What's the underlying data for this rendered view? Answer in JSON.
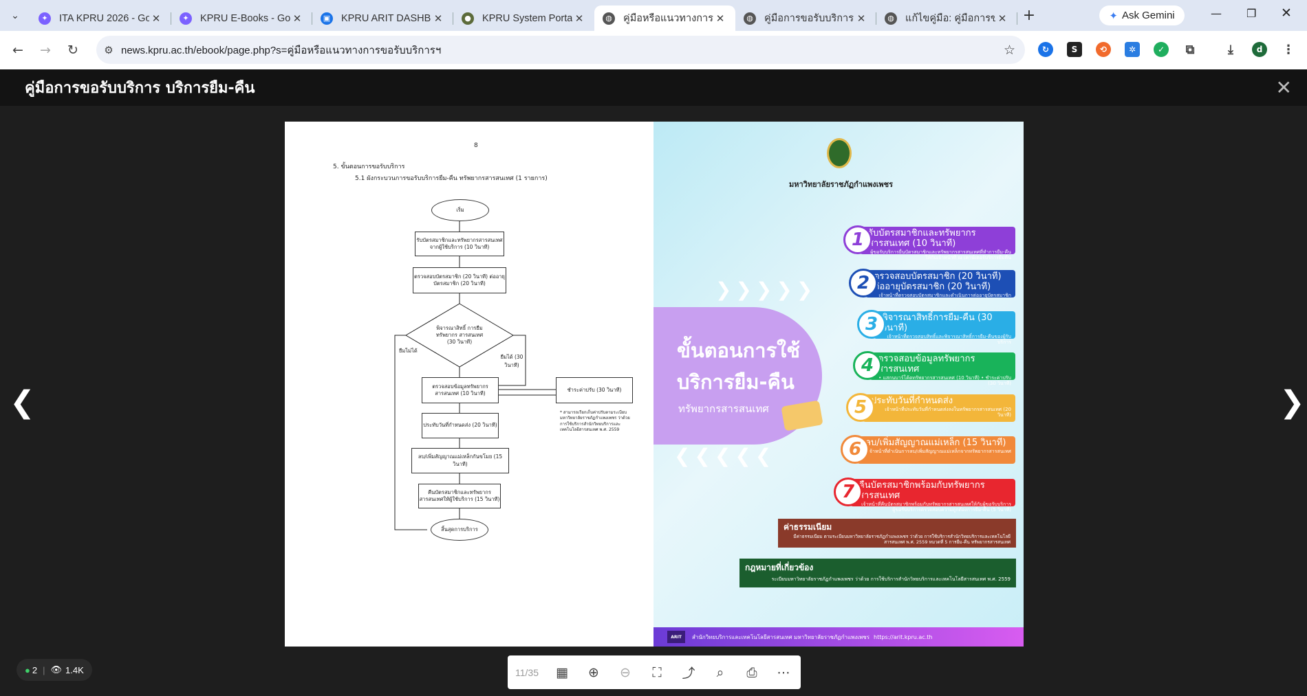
{
  "tabs": [
    {
      "title": "ITA KPRU 2026 - Goo",
      "color": "#7b61ff",
      "glyph": "✦"
    },
    {
      "title": "KPRU E-Books - Goo",
      "color": "#7b61ff",
      "glyph": "✦"
    },
    {
      "title": "KPRU ARIT DASHBOA",
      "color": "#1a73e8",
      "glyph": "▣"
    },
    {
      "title": "KPRU System Portal",
      "color": "#5c6b3a",
      "glyph": "●"
    },
    {
      "title": "คู่มือหรือแนวทางการ",
      "color": "#555555",
      "glyph": "◍"
    },
    {
      "title": "คู่มือการขอรับบริการ บริ",
      "color": "#555555",
      "glyph": "◍"
    },
    {
      "title": "แก้ไขคู่มือ: คู่มือการขอรั",
      "color": "#555555",
      "glyph": "◍"
    }
  ],
  "gemini_label": "Ask Gemini",
  "url": "news.kpru.ac.th/ebook/page.php?s=คู่มือหรือแนวทางการขอรับบริการฯ",
  "profile_initial": "d",
  "viewer_title": "คู่มือการขอรับบริการ บริการยืม-คืน",
  "left_page": {
    "page_number": "8",
    "heading": "5. ขั้นตอนการขอรับบริการ",
    "subheading": "5.1 ผังกระบวนการขอรับบริการยืม-คืน ทรัพยากรสารสนเทศ (1 รายการ)",
    "start": "เริ่ม",
    "box1": "รับบัตรสมาชิกและทรัพยากรสารสนเทศ จากผู้ใช้บริการ (10 วินาที)",
    "box2": "ตรวจสอบบัตรสมาชิก (20 วินาที) ต่ออายุบัตรสมาชิก (20 วินาที)",
    "decision": "พิจารณาสิทธิ์ การยืมทรัพยากร สารสนเทศ (30 วินาที)",
    "no_label": "ยืมไม่ได้",
    "yes_label": "ยืมได้ (30 วินาที)",
    "box3": "ตรวจสอบข้อมูลทรัพยากร สารสนเทศ (10 วินาที)",
    "side_box": "ชำระค่าปรับ (30 วินาที)",
    "note": "* สามารถเรียกเก็บค่าปรับตามระเบียบมหาวิทยาลัยราชภัฏกำแพงเพชร ว่าด้วยการใช้บริการสำนักวิทยบริการและเทคโนโลยีสารสนเทศ พ.ศ. 2559",
    "box4": "ประทับวันที่กำหนดส่ง (20 วินาที)",
    "box5": "ลบ/เพิ่มสัญญาณแม่เหล็กกันขโมย (15 วินาที)",
    "box6": "คืนบัตรสมาชิกและทรัพยากร สารสนเทศให้ผู้ใช้บริการ (15 วินาที)",
    "end": "สิ้นสุดการบริการ"
  },
  "right_page": {
    "university": "มหาวิทยาลัยราชภัฏกำแพงเพชร",
    "headline1": "ขั้นตอนการใช้",
    "headline2": "บริการยืม-คืน",
    "headline3": "ทรัพยากรสารสนเทศ",
    "steps": [
      {
        "n": "1",
        "title": "รับบัตรสมาชิกและทรัพยากรสารสนเทศ (10 วินาที)",
        "sub": "ผู้ขอรับบริการยื่นบัตรสมาชิกและทรัพยากรสารสนเทศที่ทำการยืม-คืน ให้กับเจ้าหน้าที่ ณ เคาน์เตอร์บริการยืมคืน",
        "color": "#8e3fd8"
      },
      {
        "n": "2",
        "title": "ตรวจสอบบัตรสมาชิก (20 วินาที) ต่ออายุบัตรสมาชิก (20 วินาที)",
        "sub": "เจ้าหน้าที่ตรวจสอบบัตรสมาชิกและดำเนินการต่ออายุบัตรสมาชิก",
        "color": "#1d4fb5"
      },
      {
        "n": "3",
        "title": "พิจารณาสิทธิ์การยืม-คืน (30 วินาที)",
        "sub": "เจ้าหน้าที่ตรวจสอบสิทธิ์และพิจารณาสิทธิ์การยืม-คืนของผู้รับบริการ",
        "color": "#2aaee6"
      },
      {
        "n": "4",
        "title": "ตรวจสอบข้อมูลทรัพยากรสารสนเทศ",
        "sub": "• แสกนบาร์โค้ดทรัพยากรสารสนเทศ (10 วินาที) • ชำระค่าปรับ (30 วินาที)",
        "color": "#19b35a"
      },
      {
        "n": "5",
        "title": "ประทับวันที่กำหนดส่ง",
        "sub": "เจ้าหน้าที่ประทับวันที่กำหนดส่งลงในทรัพยากรสารสนเทศ (20 วินาที)",
        "color": "#f3b63a"
      },
      {
        "n": "6",
        "title": "ลบ/เพิ่มสัญญาณแม่เหล็ก (15 วินาที)",
        "sub": "เจ้าหน้าที่ดำเนินการลบ/เพิ่มสัญญาณแม่เหล็กจากทรัพยากรสารสนเทศ",
        "color": "#f1893a"
      },
      {
        "n": "7",
        "title": "คืนบัตรสมาชิกพร้อมกับทรัพยากรสารสนเทศ",
        "sub": "เจ้าหน้าที่คืนบัตรสมาชิกพร้อมกับทรัพยากรสารสนเทศให้กับผู้ขอรับบริการ ผู้ขอรับบริการตรวจสอบความถูกต้องการยืม-คืน (5 วินาที)",
        "color": "#e8262f"
      }
    ],
    "fee_title": "ค่าธรรมเนียม",
    "fee_text": "มีค่าธรรมเนียม ตามระเบียบมหาวิทยาลัยราชภัฏกำแพงเพชร ว่าด้วย การใช้บริการสำนักวิทยบริการและเทคโนโลยีสารสนเทศ พ.ศ. 2559 หมวดที่ 5 การยืม-คืน ทรัพยากรสารสนเทศ",
    "law_title": "กฎหมายที่เกี่ยวข้อง",
    "law_text": "ระเบียบมหาวิทยาลัยราชภัฏกำแพงเพชร ว่าด้วย การใช้บริการสำนักวิทยบริการและเทคโนโลยีสารสนเทศ พ.ศ. 2559",
    "footer_logo": "ARIT",
    "footer": "สำนักวิทยบริการและเทคโนโลยีสารสนเทศ มหาวิทยาลัยราชภัฏกำแพงเพชร",
    "footer_url": "https://arit.kpru.ac.th"
  },
  "toolbar": {
    "page": "11/35"
  },
  "stats": {
    "online": "2",
    "views": "1.4K"
  }
}
